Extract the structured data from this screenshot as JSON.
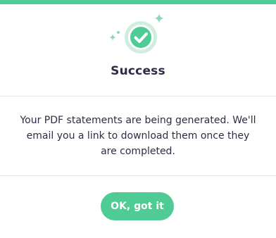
{
  "dialog": {
    "title": "Success",
    "message_lines": [
      "Your PDF statements are being generated. We'll",
      "email you a link to download them once they",
      "are completed."
    ],
    "ok_button_label": "OK, got it"
  },
  "icons": {
    "status": "check-circle-icon",
    "decoration": "sparkle-icon"
  },
  "colors": {
    "accent": "#4fcb95",
    "accent_light": "#cfeee0",
    "text": "#2f2b45",
    "divider": "#e6e6ee",
    "background": "#ffffff"
  }
}
